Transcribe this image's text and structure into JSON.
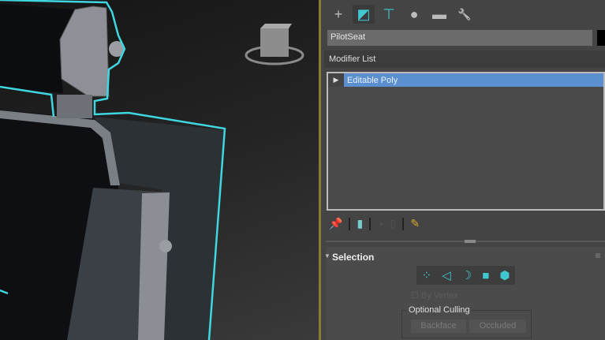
{
  "command_panel": {
    "tabs": [
      {
        "name": "create",
        "icon": "plus-icon",
        "glyph": "+"
      },
      {
        "name": "modify",
        "icon": "modify-icon",
        "glyph": "◩"
      },
      {
        "name": "hierarchy",
        "icon": "hierarchy-icon",
        "glyph": "⊤"
      },
      {
        "name": "motion",
        "icon": "motion-icon",
        "glyph": "●"
      },
      {
        "name": "display",
        "icon": "display-icon",
        "glyph": "▬"
      },
      {
        "name": "utilities",
        "icon": "wrench-icon",
        "glyph": "🔧"
      }
    ],
    "object_name": "PilotSeat",
    "object_color": "#000000",
    "modifier_list_label": "Modifier List",
    "stack_items": [
      "Editable Poly"
    ],
    "selection_rollout": {
      "title": "Selection",
      "subobject_icons": [
        "vertex-icon",
        "edge-icon",
        "border-icon",
        "polygon-icon",
        "element-icon"
      ],
      "by_vertex_label": "By Vertex",
      "optional_culling_label": "Optional Culling",
      "backface_label": "Backface",
      "occluded_label": "Occluded"
    }
  },
  "colors": {
    "selection_outline": "#3fd6e0",
    "stack_highlight": "#5b8fd0",
    "viewport_border": "#8a7a3a"
  }
}
